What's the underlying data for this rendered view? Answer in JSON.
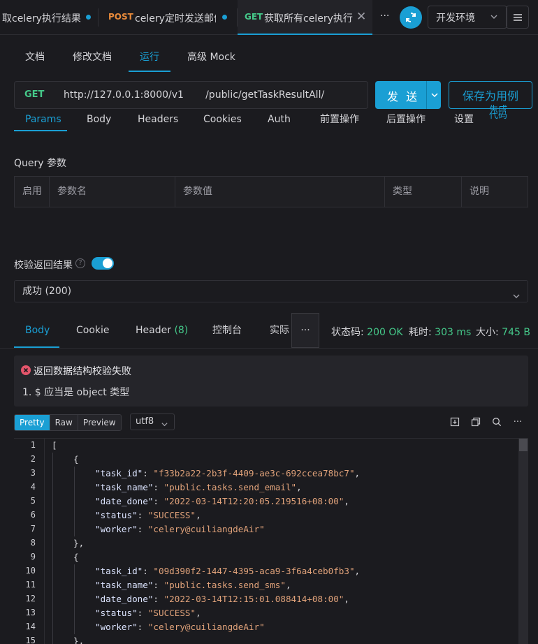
{
  "tabs": [
    {
      "method": "",
      "title": "取celery执行结果",
      "modified": true
    },
    {
      "method": "POST",
      "method_color": "#e88a3a",
      "title": "celery定时发送邮件",
      "modified": true
    },
    {
      "method": "GET",
      "method_color": "#45c98a",
      "title": "获取所有celery执行",
      "active": true
    }
  ],
  "tab_more": "···",
  "env": {
    "label": "开发环境"
  },
  "subtabs": [
    "文档",
    "修改文档",
    "运行",
    "高级 Mock"
  ],
  "request": {
    "method": "GET",
    "url": "http://127.0.0.1:8000/v1       /public/getTaskResultAll/",
    "send_label": "发 送",
    "save_label": "保存为用例"
  },
  "param_tabs": [
    "Params",
    "Body",
    "Headers",
    "Cookies",
    "Auth",
    "前置操作",
    "后置操作",
    "设置"
  ],
  "gen_code": {
    "line1": "生成",
    "line2": "代码"
  },
  "query": {
    "title": "Query 参数",
    "columns": [
      "启用",
      "参数名",
      "参数值",
      "类型",
      "说明"
    ]
  },
  "validate": {
    "label": "校验返回结果",
    "help": "?",
    "enabled": true,
    "selected": "成功 (200)"
  },
  "response_tabs": [
    "Body",
    "Cookie",
    "Header",
    "控制台",
    "实际"
  ],
  "response_header_count": "(8)",
  "response_more": "···",
  "status": {
    "code_label": "状态码:",
    "code_value": "200 OK",
    "time_label": "耗时:",
    "time_value": "303 ms",
    "size_label": "大小:",
    "size_value": "745 B"
  },
  "error": {
    "title": "返回数据结构校验失败",
    "detail": "1. $ 应当是 object 类型"
  },
  "format_buttons": [
    "Pretty",
    "Raw",
    "Preview"
  ],
  "encoding": "utf8",
  "code_lines": [
    {
      "n": "1",
      "indent": 0,
      "key": "",
      "val": "",
      "punct": "["
    },
    {
      "n": "2",
      "indent": 1,
      "key": "",
      "val": "",
      "punct": "{"
    },
    {
      "n": "3",
      "indent": 2,
      "key": "\"task_id\"",
      "val": "\"f33b2a22-2b3f-4409-ae3c-692ccea78bc7\"",
      "punct": ","
    },
    {
      "n": "4",
      "indent": 2,
      "key": "\"task_name\"",
      "val": "\"public.tasks.send_email\"",
      "punct": ","
    },
    {
      "n": "5",
      "indent": 2,
      "key": "\"date_done\"",
      "val": "\"2022-03-14T12:20:05.219516+08:00\"",
      "punct": ","
    },
    {
      "n": "6",
      "indent": 2,
      "key": "\"status\"",
      "val": "\"SUCCESS\"",
      "punct": ","
    },
    {
      "n": "7",
      "indent": 2,
      "key": "\"worker\"",
      "val": "\"celery@cuiliangdeAir\"",
      "punct": ""
    },
    {
      "n": "8",
      "indent": 1,
      "key": "",
      "val": "",
      "punct": "},"
    },
    {
      "n": "9",
      "indent": 1,
      "key": "",
      "val": "",
      "punct": "{"
    },
    {
      "n": "10",
      "indent": 2,
      "key": "\"task_id\"",
      "val": "\"09d390f2-1447-4395-aca9-3f6a4ceb0fb3\"",
      "punct": ","
    },
    {
      "n": "11",
      "indent": 2,
      "key": "\"task_name\"",
      "val": "\"public.tasks.send_sms\"",
      "punct": ","
    },
    {
      "n": "12",
      "indent": 2,
      "key": "\"date_done\"",
      "val": "\"2022-03-14T12:15:01.088414+08:00\"",
      "punct": ","
    },
    {
      "n": "13",
      "indent": 2,
      "key": "\"status\"",
      "val": "\"SUCCESS\"",
      "punct": ","
    },
    {
      "n": "14",
      "indent": 2,
      "key": "\"worker\"",
      "val": "\"celery@cuiliangdeAir\"",
      "punct": ""
    },
    {
      "n": "15",
      "indent": 1,
      "key": "",
      "val": "",
      "punct": "},"
    }
  ],
  "colors": {
    "accent": "#1a9fd4",
    "success": "#45c98a",
    "error": "#e4556b",
    "string": "#e0a27a"
  },
  "icons": [
    "sync-icon",
    "chevron-down-icon",
    "menu-icon",
    "help-icon",
    "error-icon",
    "download-icon",
    "copy-icon",
    "search-icon",
    "more-icon"
  ]
}
